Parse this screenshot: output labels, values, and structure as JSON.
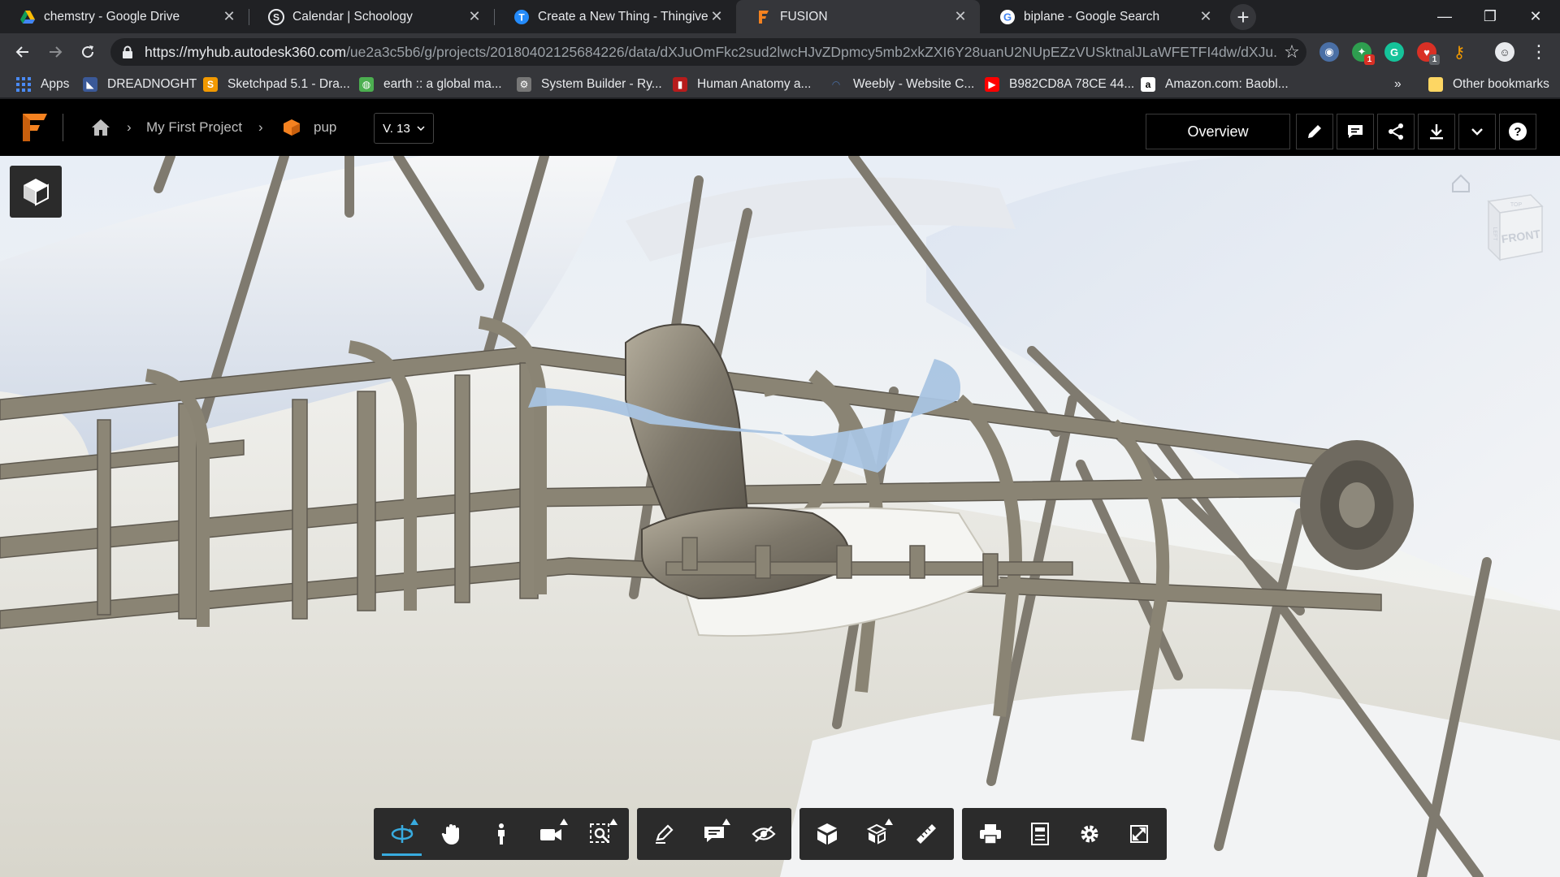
{
  "browser": {
    "tabs": [
      {
        "title": "chemstry - Google Drive",
        "icon": "google-drive-icon",
        "active": false
      },
      {
        "title": "Calendar | Schoology",
        "icon": "schoology-icon",
        "active": false
      },
      {
        "title": "Create a New Thing - Thingiverse",
        "icon": "thingiverse-icon",
        "active": false
      },
      {
        "title": "FUSION",
        "icon": "fusion-icon",
        "active": true
      },
      {
        "title": "biplane - Google Search",
        "icon": "google-icon",
        "active": false
      }
    ],
    "url_host": "https://myhub.autodesk360.com",
    "url_path": "/ue2a3c5b6/g/projects/20180402125684226/data/dXJuOmFkc2sud2lwcHJvZDpmcy5mb2xkZXI6Y28uanU2NUpEZzVUSktnalJLaWFETFI4dw/dXJu...",
    "extensions": [
      {
        "name": "eyes-extension-icon",
        "color": "#4a6fa5",
        "badge": ""
      },
      {
        "name": "puzzle-extension-icon",
        "color": "#2e9e4f",
        "badge": "1"
      },
      {
        "name": "grammarly-icon",
        "color": "#15c39a",
        "badge": ""
      },
      {
        "name": "shield-extension-icon",
        "color": "#d93025",
        "badge": "1"
      },
      {
        "name": "key-extension-icon",
        "color": "#f29900",
        "badge": ""
      }
    ],
    "bookmarks": [
      {
        "label": "Apps",
        "icon": "apps-grid-icon"
      },
      {
        "label": "DREADNOGHT",
        "icon": "dreadnought-icon"
      },
      {
        "label": "Sketchpad 5.1 - Dra...",
        "icon": "sketchpad-icon"
      },
      {
        "label": "earth :: a global ma...",
        "icon": "earth-icon"
      },
      {
        "label": "System Builder - Ry...",
        "icon": "system-builder-icon"
      },
      {
        "label": "Human Anatomy a...",
        "icon": "anatomy-icon"
      },
      {
        "label": "Weebly - Website C...",
        "icon": "weebly-icon"
      },
      {
        "label": "B982CD8A 78CE 44...",
        "icon": "youtube-icon"
      },
      {
        "label": "Amazon.com: Baobl...",
        "icon": "amazon-icon"
      }
    ],
    "overflow_chevron": "»",
    "other_bookmarks": "Other bookmarks"
  },
  "app": {
    "breadcrumb": {
      "project": "My First Project",
      "design": "pup"
    },
    "version": "V. 13",
    "overview_label": "Overview",
    "header_actions": [
      "edit-pencil-icon",
      "comment-icon",
      "share-icon",
      "download-icon",
      "more-chevron-icon",
      "help-icon"
    ]
  },
  "viewer": {
    "viewcube_face": "FRONT",
    "viewcube_top": "TOP",
    "viewcube_side": "LEFT",
    "active_tool": "orbit-tool",
    "colors": {
      "accent": "#38abdf",
      "toolbar": "#2b2b2b",
      "frame": "#8a8474",
      "wing": "#eef1f5"
    },
    "toolbar_groups": [
      [
        "orbit-tool-icon",
        "pan-tool-icon",
        "walk-tool-icon",
        "camera-tool-icon",
        "zoom-window-icon"
      ],
      [
        "markup-pencil-icon",
        "comment-tool-icon",
        "hide-eye-icon"
      ],
      [
        "model-browser-icon",
        "explode-icon",
        "measure-ruler-icon"
      ],
      [
        "print-icon",
        "properties-icon",
        "settings-gear-icon",
        "fullscreen-icon"
      ]
    ]
  }
}
